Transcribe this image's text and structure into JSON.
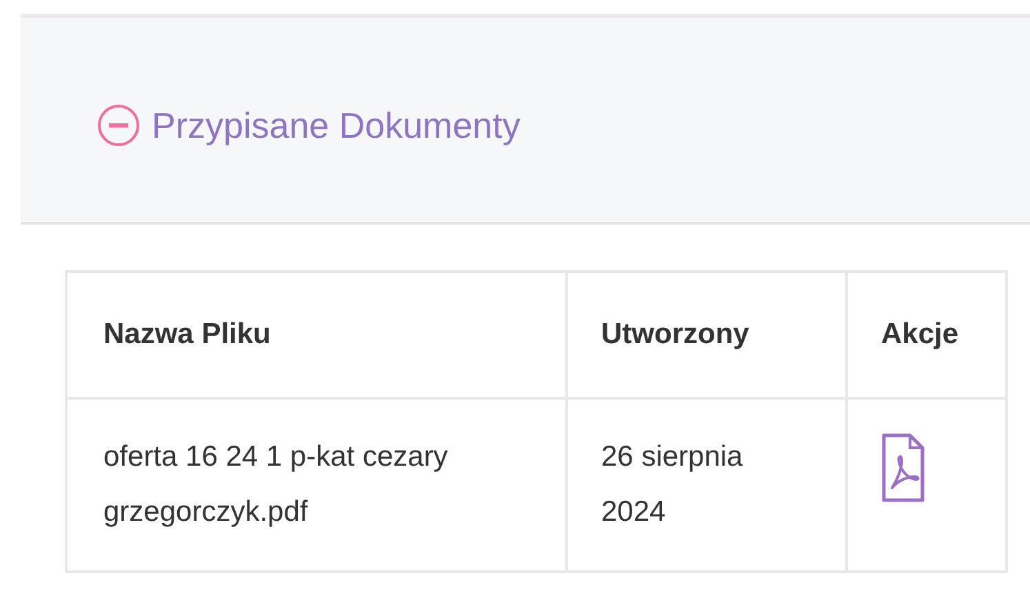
{
  "section": {
    "title": "Przypisane Dokumenty",
    "expanded": true
  },
  "table": {
    "columns": [
      "Nazwa Pliku",
      "Utworzony",
      "Akcje"
    ],
    "rows": [
      {
        "file_name": "oferta 16 24 1 p-kat cezary grzegorczyk.pdf",
        "created": "26 sierpnia 2024",
        "actions": [
          {
            "kind": "pdf"
          }
        ]
      }
    ]
  }
}
